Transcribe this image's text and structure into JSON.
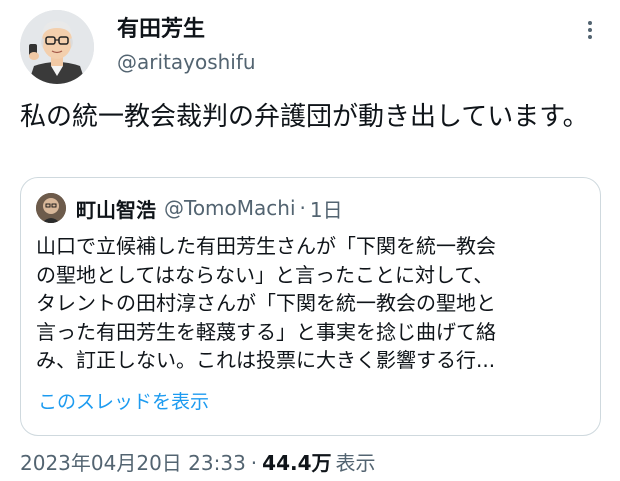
{
  "author": {
    "name": "有田芳生",
    "handle": "@aritayoshifu"
  },
  "tweet": {
    "text": "私の統一教会裁判の弁護団が動き出しています。"
  },
  "quote": {
    "author_name": "町山智浩",
    "author_handle": "@TomoMachi",
    "separator": "·",
    "time": "1日",
    "lines": [
      "山口で立候補した有田芳生さんが「下関を統一教会",
      "の聖地としてはならない」と言ったことに対して、",
      "タレントの田村淳さんが「下関を統一教会の聖地と",
      "言った有田芳生を軽蔑する」と事実を捻じ曲げて絡",
      "み、訂正しない。これは投票に大きく影響する行..."
    ],
    "show_thread": "このスレッドを表示"
  },
  "meta": {
    "timestamp": "2023年04月20日 23:33",
    "separator": "·",
    "views_count": "44.4万",
    "views_label": "表示"
  },
  "colors": {
    "text": "#0f1419",
    "secondary": "#536471",
    "link": "#1d9bf0",
    "border": "#cfd9de"
  },
  "icons": {
    "more": "more-vertical-icon"
  }
}
